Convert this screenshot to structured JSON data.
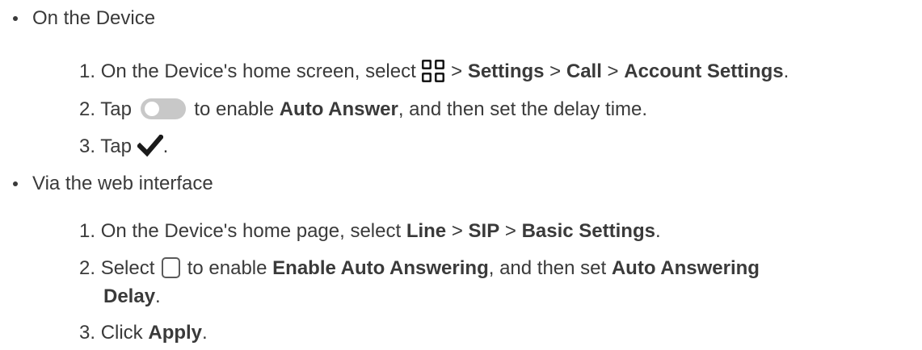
{
  "sections": [
    {
      "title": "On the Device",
      "steps": [
        {
          "number": "1.",
          "text_before": "On the Device's home screen, select ",
          "icon": "apps-grid-icon",
          "sep1": " > ",
          "b1": "Settings",
          "sep2": " > ",
          "b2": "Call",
          "sep3": " > ",
          "b3": "Account Settings",
          "end": "."
        },
        {
          "number": "2.",
          "text_before": "Tap ",
          "icon": "toggle-switch-icon",
          "text_mid": " to enable ",
          "b1": "Auto Answer",
          "text_after": ", and then set the delay time."
        },
        {
          "number": "3.",
          "text_before": "Tap ",
          "icon": "checkmark-icon",
          "end": "."
        }
      ]
    },
    {
      "title": "Via the web interface",
      "steps": [
        {
          "number": "1.",
          "text_before": "On the Device's home page, select ",
          "b1": "Line",
          "sep1": " > ",
          "b2": "SIP",
          "sep2": " > ",
          "b3": "Basic Settings",
          "end": "."
        },
        {
          "number": "2.",
          "text_before": "Select ",
          "icon": "checkbox-icon",
          "text_mid": " to enable ",
          "b1": "Enable Auto Answering",
          "text_mid2": ", and then set ",
          "b2a": "Auto Answering",
          "b2b": "Delay",
          "end": "."
        },
        {
          "number": "3.",
          "text_before": "Click ",
          "b1": "Apply",
          "end": "."
        }
      ]
    }
  ],
  "colors": {
    "text": "#3a3a3a",
    "toggle_track": "#c8c8c8",
    "icon_dark": "#1a1a1a"
  }
}
